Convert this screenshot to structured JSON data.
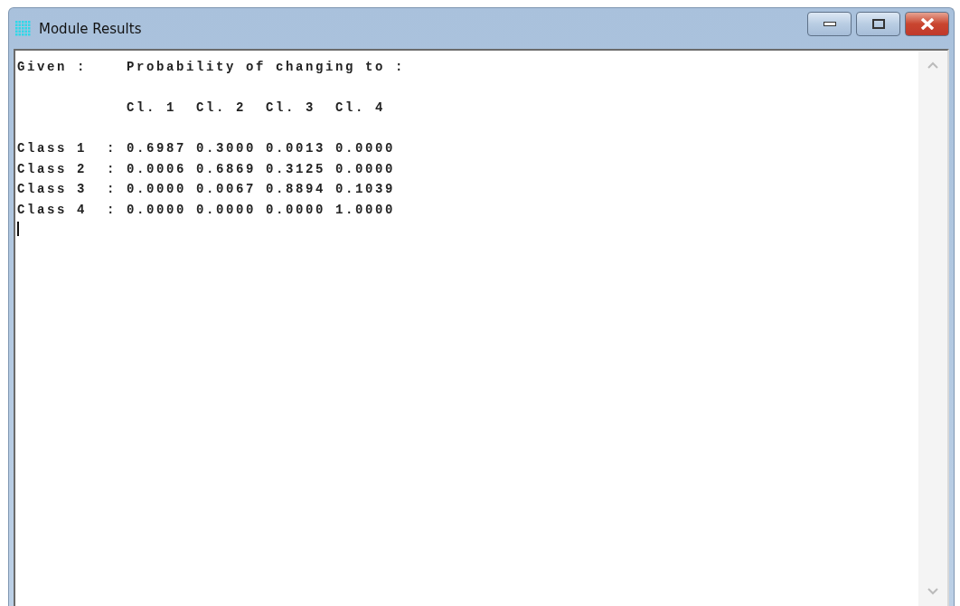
{
  "window": {
    "title": "Module Results"
  },
  "output": {
    "heading": "Given :    Probability of changing to :",
    "column_headers": "           Cl. 1  Cl. 2  Cl. 3  Cl. 4",
    "rows": [
      "Class 1  : 0.6987 0.3000 0.0013 0.0000",
      "Class 2  : 0.0006 0.6869 0.3125 0.0000",
      "Class 3  : 0.0000 0.0067 0.8894 0.1039",
      "Class 4  : 0.0000 0.0000 0.0000 1.0000"
    ]
  }
}
